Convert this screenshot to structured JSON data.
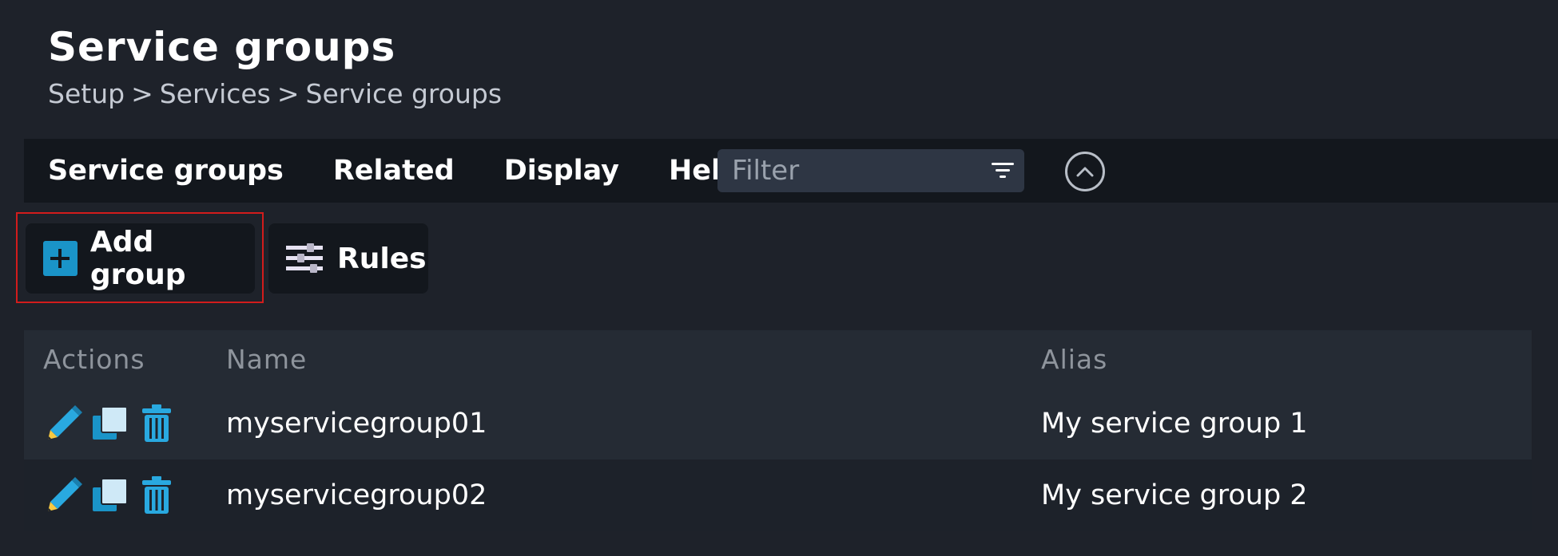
{
  "header": {
    "title": "Service groups",
    "breadcrumb": [
      "Setup",
      "Services",
      "Service groups"
    ],
    "breadcrumb_separator": ">"
  },
  "menubar": {
    "items": [
      "Service groups",
      "Related",
      "Display",
      "Help"
    ],
    "filter_placeholder": "Filter"
  },
  "actions": {
    "add_group_label": "Add group",
    "rules_label": "Rules"
  },
  "table": {
    "columns": [
      "Actions",
      "Name",
      "Alias"
    ],
    "rows": [
      {
        "name": "myservicegroup01",
        "alias": "My service group 1"
      },
      {
        "name": "myservicegroup02",
        "alias": "My service group 2"
      }
    ]
  },
  "colors": {
    "background": "#1e222a",
    "menubar": "#13171d",
    "accent_blue": "#1a94c8",
    "highlight_red": "#d21c1c",
    "pencil_yellow": "#f5c842"
  }
}
